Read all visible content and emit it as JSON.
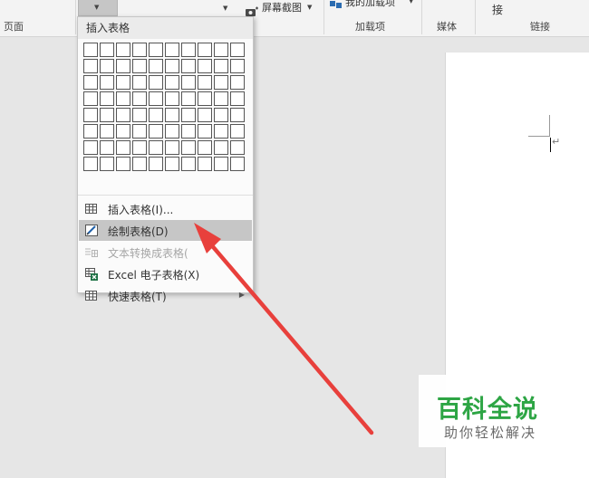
{
  "ribbon": {
    "group_page_label": "页面",
    "screenshot_label": "屏幕截图",
    "addins_item_label": "我的加载项",
    "group_addins_label": "加载项",
    "group_media_label": "媒体",
    "link_item_label": "接",
    "group_links_label": "链接"
  },
  "menu": {
    "title": "插入表格",
    "grid": {
      "rows": 8,
      "cols": 10
    },
    "items": [
      {
        "label": "插入表格(I)...",
        "icon": "table-icon",
        "state": "normal"
      },
      {
        "label": "绘制表格(D)",
        "icon": "draw-table-icon",
        "state": "highlighted"
      },
      {
        "label": "文本转换成表格(",
        "icon": "text-to-table-icon",
        "state": "disabled"
      },
      {
        "label": "Excel 电子表格(X)",
        "icon": "excel-icon",
        "state": "normal"
      },
      {
        "label": "快速表格(T)",
        "icon": "quick-table-icon",
        "state": "normal",
        "submenu": true
      }
    ]
  },
  "colors": {
    "arrow": "#e8403c",
    "highlight": "#c6c6c6",
    "watermark_green": "#2da544"
  },
  "watermark": {
    "title": "百科全说",
    "subtitle": "助你轻松解决"
  }
}
